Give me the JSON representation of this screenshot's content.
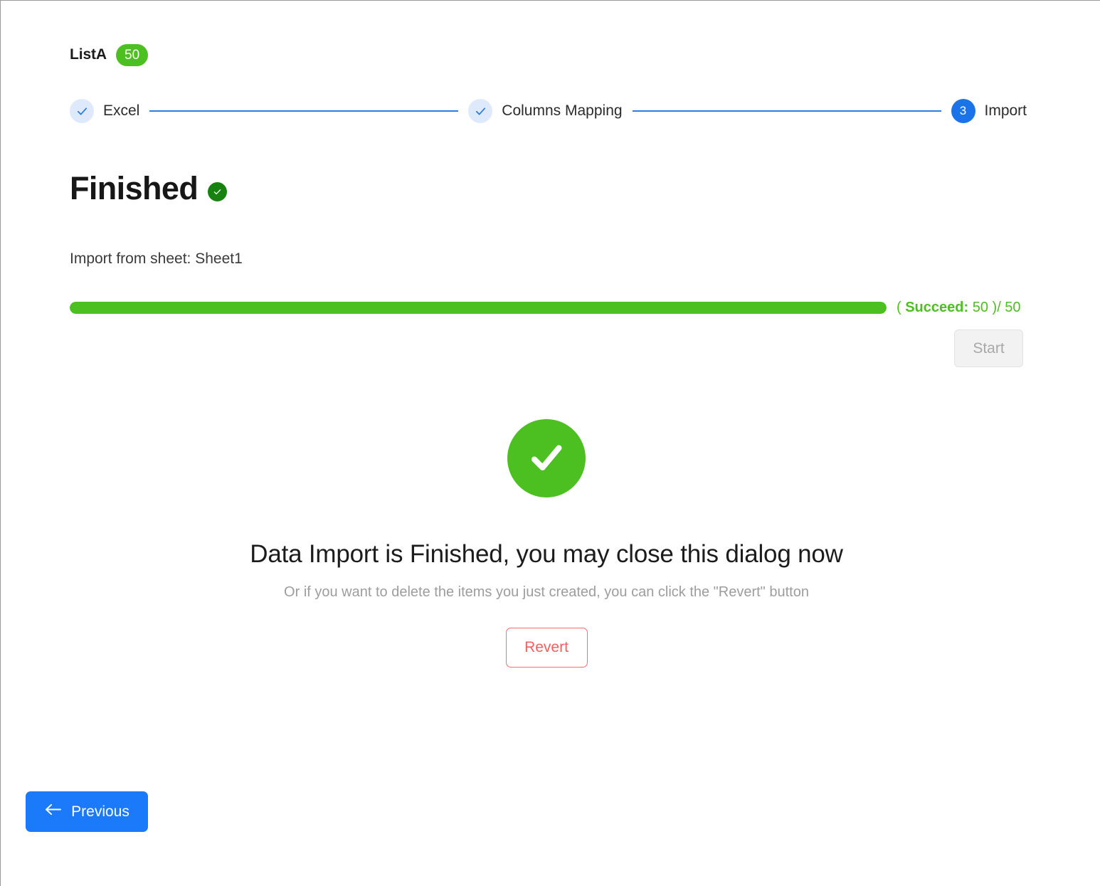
{
  "header": {
    "list_name": "ListA",
    "item_count": "50"
  },
  "stepper": {
    "steps": [
      {
        "label": "Excel",
        "marker": "check",
        "state": "done"
      },
      {
        "label": "Columns Mapping",
        "marker": "check",
        "state": "done"
      },
      {
        "label": "Import",
        "marker": "3",
        "state": "active"
      }
    ]
  },
  "status": {
    "heading": "Finished",
    "heading_badge_icon": "check-circle-icon",
    "sheet_note": "Import from sheet: Sheet1"
  },
  "progress": {
    "percent": 100,
    "prefix": "( ",
    "succeed_label": "Succeed:",
    "succeed_value": " 50 )",
    "total": "/ 50",
    "bar_color": "#4cc020"
  },
  "actions": {
    "start_label": "Start",
    "start_disabled": true,
    "revert_label": "Revert",
    "previous_label": "Previous"
  },
  "success": {
    "icon": "check-circle-icon",
    "title": "Data Import is Finished, you may close this dialog now",
    "subtitle": "Or if you want to delete the items you just created, you can click the \"Revert\" button"
  },
  "colors": {
    "accent_blue": "#1a7afa",
    "success_green": "#4cc020",
    "dark_green": "#17820f",
    "danger_red": "#fb5d5d",
    "step_done_bg": "#deeafb"
  }
}
